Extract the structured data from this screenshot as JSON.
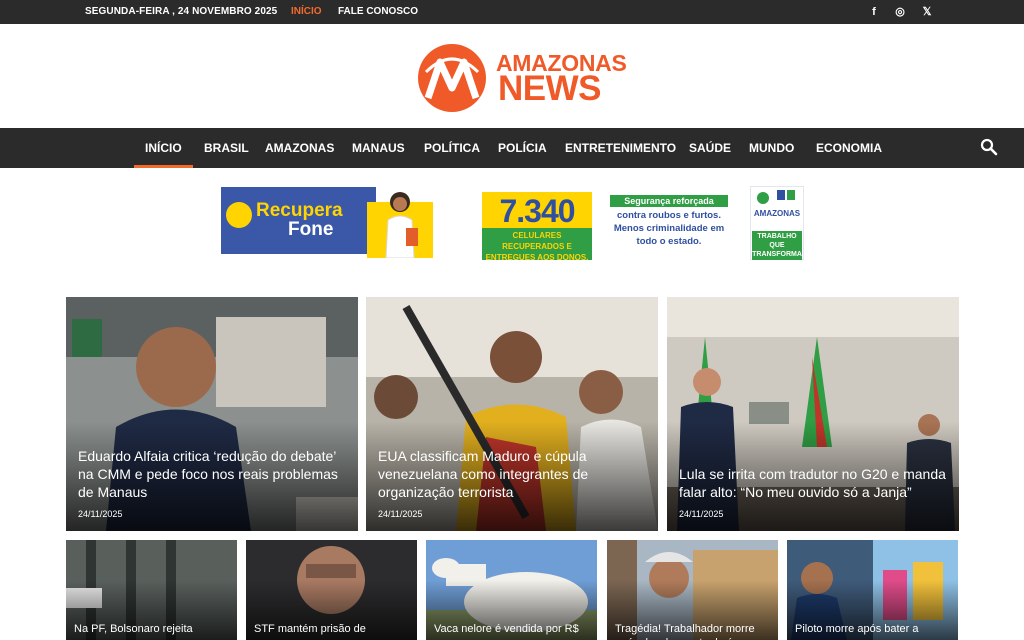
{
  "topbar": {
    "date": "SEGUNDA-FEIRA , 24 NOVEMBRO 2025",
    "links": [
      "INÍCIO",
      "FALE CONOSCO"
    ],
    "social": [
      {
        "icon": "facebook-icon",
        "glyph": "f"
      },
      {
        "icon": "instagram-icon",
        "glyph": "◎"
      },
      {
        "icon": "x-icon",
        "glyph": "𝕏"
      }
    ]
  },
  "logo": {
    "word1": "AMAZONAS",
    "word2": "NEWS",
    "color": "#f05a28"
  },
  "nav": {
    "items": [
      "INÍCIO",
      "BRASIL",
      "AMAZONAS",
      "MANAUS",
      "POLÍTICA",
      "POLÍCIA",
      "ENTRETENIMENTO",
      "SAÚDE",
      "MUNDO",
      "ECONOMIA"
    ],
    "active": "INÍCIO",
    "accent": "#f26a2e"
  },
  "banner": {
    "brand1": "Recupera",
    "brand2": "Fone",
    "number": "7.340",
    "number_sub": "CELULARES RECUPERADOS E ENTREGUES AOS DONOS.",
    "tag": "Segurança reforçada",
    "text": "contra roubos e furtos. Menos criminalidade em todo o estado.",
    "badge_top": "AMAZONAS",
    "badge_bottom": "TRABALHO QUE TRANSFORMA"
  },
  "featured": [
    {
      "title": "Eduardo Alfaia critica ‘redução do debate’ na CMM e pede foco nos reais problemas de Manaus",
      "date": "24/11/2025"
    },
    {
      "title": "EUA classificam Maduro e cúpula venezuelana como integrantes de organização terrorista",
      "date": "24/11/2025"
    },
    {
      "title": "Lula se irrita com tradutor no G20 e manda falar alto: “No meu ouvido só a Janja”",
      "date": "24/11/2025"
    }
  ],
  "small": [
    {
      "title": "Na PF, Bolsonaro rejeita"
    },
    {
      "title": "STF mantém prisão de"
    },
    {
      "title": "Vaca nelore é vendida por R$"
    },
    {
      "title": "Tragédia! Trabalhador morre após desabamento da árvore"
    },
    {
      "title": "Piloto morre após bater a"
    }
  ]
}
